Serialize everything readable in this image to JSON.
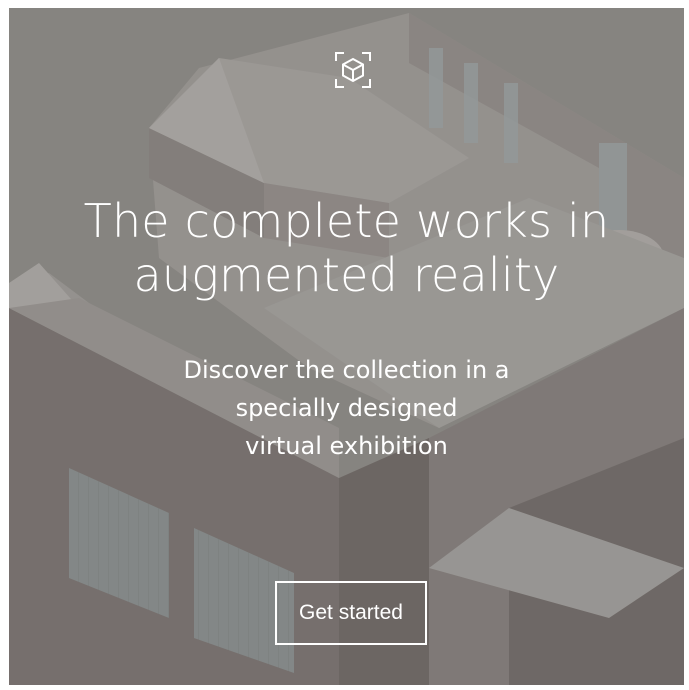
{
  "hero": {
    "icon": "ar-cube-icon",
    "headline_line1": "The complete works in",
    "headline_line2": "augmented reality",
    "sub_line1": "Discover the collection in a",
    "sub_line2": "specially designed",
    "sub_line3": "virtual exhibition",
    "cta_label": "Get started"
  },
  "colors": {
    "background": "#8d8a86",
    "text": "#ffffff",
    "building_wall": "#7b7472",
    "building_roof": "#a19e9a",
    "glass": "#9aa3a6"
  }
}
